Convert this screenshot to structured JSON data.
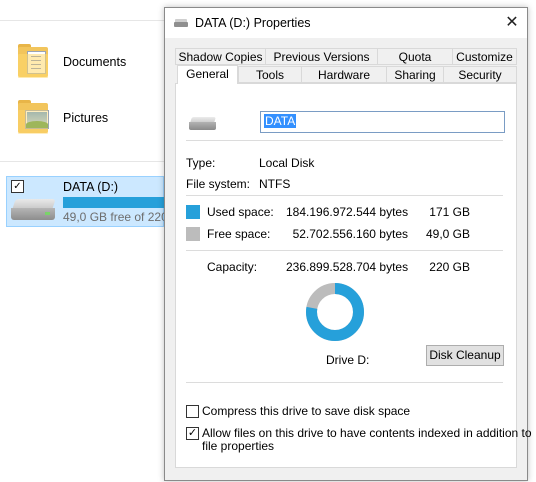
{
  "explorer": {
    "documents_label": "Documents",
    "pictures_label": "Pictures",
    "drive_name": "DATA (D:)",
    "drive_free": "49,0 GB free of 220",
    "drive_checked": "✓"
  },
  "dialog": {
    "title": "DATA (D:) Properties",
    "close": "✕",
    "tabs_top": [
      "Shadow Copies",
      "Previous Versions",
      "Quota",
      "Customize"
    ],
    "tabs_bottom": [
      "General",
      "Tools",
      "Hardware",
      "Sharing",
      "Security"
    ],
    "active_tab": "General",
    "drive_label_value": "DATA",
    "type_label": "Type:",
    "type_value": "Local Disk",
    "fs_label": "File system:",
    "fs_value": "NTFS",
    "used_label": "Used space:",
    "used_bytes": "184.196.972.544 bytes",
    "used_gb": "171 GB",
    "free_label": "Free space:",
    "free_bytes": "52.702.556.160 bytes",
    "free_gb": "49,0 GB",
    "capacity_label": "Capacity:",
    "capacity_bytes": "236.899.528.704 bytes",
    "capacity_gb": "220 GB",
    "drive_caption": "Drive D:",
    "disk_cleanup": "Disk Cleanup",
    "compress_label": "Compress this drive to save disk space",
    "compress_checked": false,
    "index_label_line1": "Allow files on this drive to have contents indexed in addition to",
    "index_label_line2": "file properties",
    "index_checked": "✓",
    "used_fraction": 0.777
  },
  "colors": {
    "used": "#26a0da",
    "free": "#bcbcbc",
    "selection_tile": "#cce8ff",
    "text_selection": "#3390ff"
  },
  "icons": [
    "folder-documents-icon",
    "folder-pictures-icon",
    "drive-icon",
    "close-icon",
    "checkbox-icon"
  ]
}
